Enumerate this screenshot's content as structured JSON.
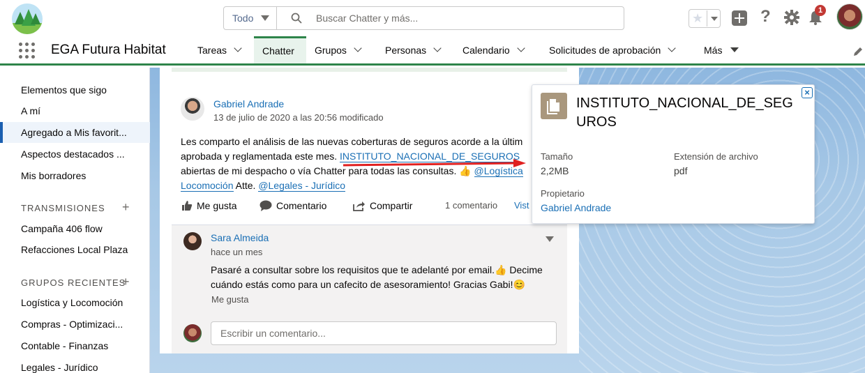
{
  "header": {
    "search_scope": "Todo",
    "search_placeholder": "Buscar Chatter y más...",
    "notification_count": "1",
    "icons": [
      "search-icon",
      "favorites-star-icon",
      "global-actions-plus-icon",
      "help-icon",
      "setup-gear-icon",
      "notifications-bell-icon"
    ]
  },
  "nav": {
    "app_name": "EGA Futura Habitat",
    "items": [
      {
        "label": "Tareas",
        "has_menu": true
      },
      {
        "label": "Chatter",
        "active": true
      },
      {
        "label": "Grupos",
        "has_menu": true
      },
      {
        "label": "Personas",
        "has_menu": true
      },
      {
        "label": "Calendario",
        "has_menu": true
      },
      {
        "label": "Solicitudes de aprobación",
        "has_menu": true
      },
      {
        "label": "Más"
      }
    ]
  },
  "sidebar": {
    "items": [
      {
        "label": "Elementos que sigo"
      },
      {
        "label": "A mí"
      },
      {
        "label": "Agregado a Mis favorit..."
      },
      {
        "label": "Aspectos destacados ..."
      },
      {
        "label": "Mis borradores"
      }
    ],
    "streams_heading": "TRANSMISIONES",
    "streams": [
      {
        "label": "Campaña 406 flow"
      },
      {
        "label": "Refacciones Local Plaza"
      }
    ],
    "groups_heading": "GRUPOS RECIENTES",
    "groups": [
      {
        "label": "Logística y Locomoción"
      },
      {
        "label": "Compras - Optimizaci..."
      },
      {
        "label": "Contable - Finanzas"
      },
      {
        "label": "Legales - Jurídico"
      }
    ]
  },
  "post": {
    "author": "Gabriel Andrade",
    "date": "13 de julio de 2020 a las 20:56 modificado",
    "line1": "Les comparto el análisis de las nuevas coberturas de seguros acorde a la últim",
    "line2_pre": "aprobada y reglamentada este mes. ",
    "file_link": "INSTITUTO_NACIONAL_DE_SEGUROS",
    "line3_pre": "abiertas de mi despacho o vía Chatter para todas las consultas. 👍 ",
    "mention_1a": "@Logística",
    "mention_1b": "Locomoción",
    "line4_mid": " Atte. ",
    "mention_2": "@Legales - Jurídico",
    "like": "Me gusta",
    "comment": "Comentario",
    "share": "Compartir",
    "comment_count": "1 comentario",
    "views": "Vist"
  },
  "comment": {
    "author": "Sara Almeida",
    "time": "hace un mes",
    "line1": "Pasaré a consultar sobre los requisitos que te adelanté por email.👍 Decime",
    "line2": "cuándo estás como para un cafecito de asesoramiento! Gracias Gabi!😊",
    "like": "Me gusta",
    "input_placeholder": "Escribir un comentario..."
  },
  "popover": {
    "title": "INSTITUTO_NACIONAL_DE_SEGUROS",
    "size_label": "Tamaño",
    "size_value": "2,2MB",
    "ext_label": "Extensión de archivo",
    "ext_value": "pdf",
    "owner_label": "Propietario",
    "owner_value": "Gabriel Andrade",
    "close_glyph": "×"
  },
  "colors": {
    "brand_green": "#2e844a",
    "link_blue": "#1a6fb5",
    "annotation_red": "#e02020",
    "file_icon": "#a9977d"
  }
}
